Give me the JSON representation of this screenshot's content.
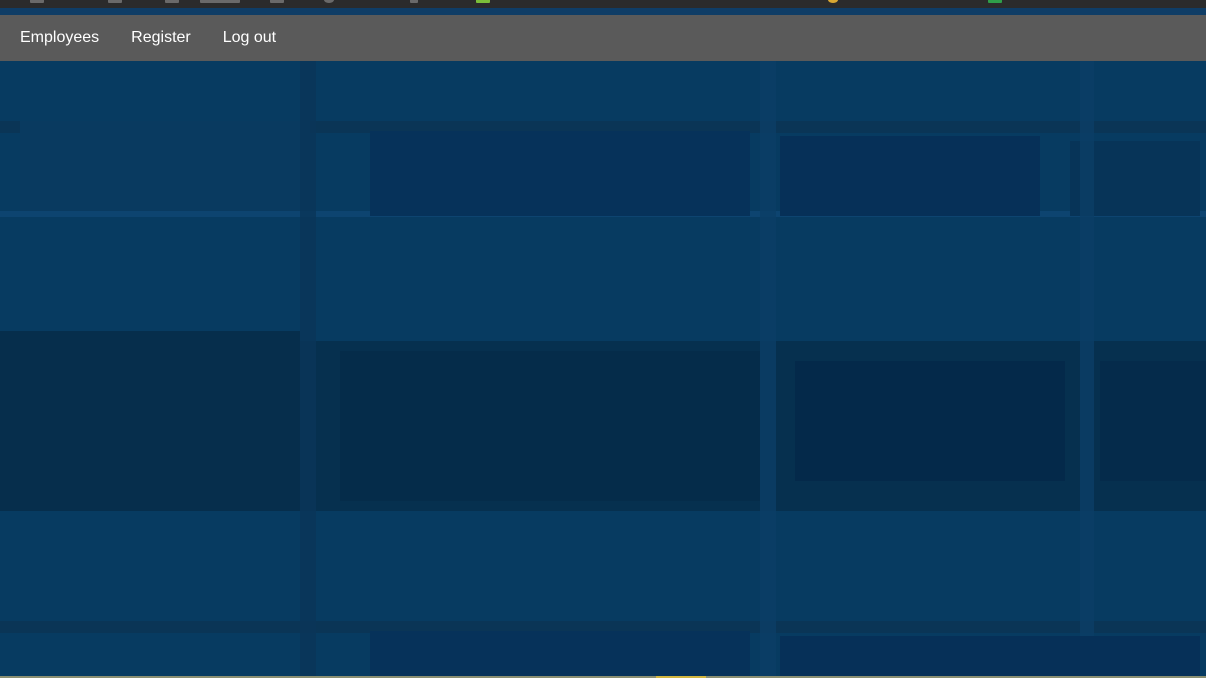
{
  "navbar": {
    "links": [
      {
        "label": "Employees"
      },
      {
        "label": "Register"
      },
      {
        "label": "Log out"
      }
    ]
  },
  "colors": {
    "navbar_bg": "#5a5a5a",
    "hero_overlay": "#073b61",
    "nav_text": "#ffffff"
  }
}
